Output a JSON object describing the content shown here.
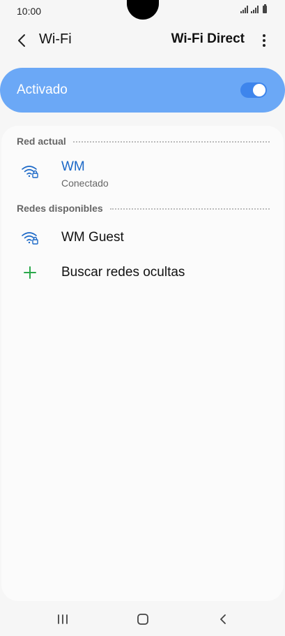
{
  "status": {
    "time": "10:00"
  },
  "header": {
    "title": "Wi-Fi",
    "wifi_direct": "Wi-Fi Direct"
  },
  "master_switch": {
    "label": "Activado",
    "on": true
  },
  "current": {
    "section_label": "Red actual",
    "network": {
      "name": "WM",
      "status": "Conectado"
    }
  },
  "available": {
    "section_label": "Redes disponibles",
    "networks": [
      {
        "name": "WM Guest"
      }
    ],
    "add_hidden": "Buscar redes ocultas"
  },
  "colors": {
    "accent": "#1b68c7",
    "switch_bar": "#6ba8f6",
    "toggle": "#3e85ec",
    "plus": "#2aa84a"
  },
  "icons": [
    "back-icon",
    "more-vert-icon",
    "wifi-lock-icon",
    "plus-icon",
    "recent-apps-icon",
    "home-icon",
    "nav-back-icon"
  ]
}
